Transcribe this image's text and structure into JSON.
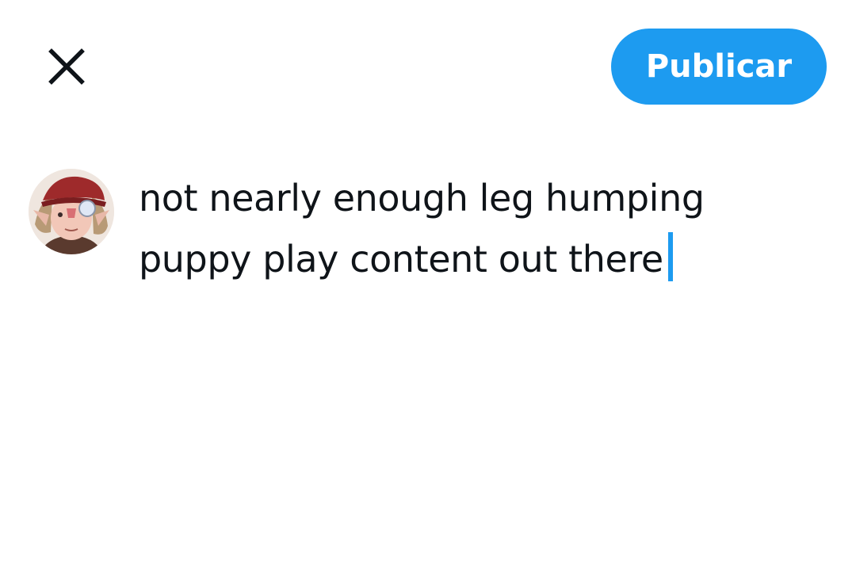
{
  "header": {
    "close_icon": "close-icon",
    "publish_label": "Publicar"
  },
  "composer": {
    "avatar_icon": "user-avatar",
    "line1": "not nearly enough leg humping",
    "line2": "puppy play content out there"
  },
  "colors": {
    "accent": "#1d9bf0",
    "text": "#0f1419",
    "background": "#ffffff"
  }
}
